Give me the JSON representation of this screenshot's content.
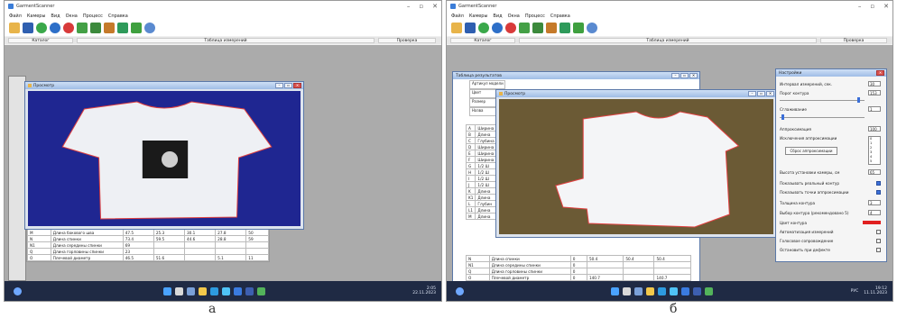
{
  "panel_a": {
    "app_title": "GarmentScanner",
    "menu": [
      "Файл",
      "Камеры",
      "Вид",
      "Окна",
      "Процесс",
      "Справка"
    ],
    "tabs": [
      "Каталог",
      "Таблица измерений",
      "Проверка"
    ],
    "preview_title": "Просмотр",
    "table_rows": [
      {
        "code": "M",
        "name": "Длина бокового шва",
        "v1": "47.5",
        "v2": "25.3",
        "v3": "30.1",
        "v4": "27.8",
        "v5": "50"
      },
      {
        "code": "N",
        "name": "Длина спинки",
        "v1": "73.4",
        "v2": "59.5",
        "v3": "44.6",
        "v4": "28.8",
        "v5": "59"
      },
      {
        "code": "N1",
        "name": "Длина середины спинки",
        "v1": "69",
        "v2": "",
        "v3": "",
        "v4": "",
        "v5": ""
      },
      {
        "code": "Q",
        "name": "Длина горловины спинки",
        "v1": "23",
        "v2": "",
        "v3": "",
        "v4": "",
        "v5": ""
      },
      {
        "code": "O",
        "name": "Плечевой диаметр",
        "v1": "46.5",
        "v2": "51.6",
        "v3": "",
        "v4": "5.1",
        "v5": "11"
      }
    ],
    "tray_time": "2:05",
    "tray_date": "22.11.2023",
    "caption": "а"
  },
  "panel_b": {
    "app_title": "GarmentScanner",
    "menu": [
      "Файл",
      "Камеры",
      "Вид",
      "Окна",
      "Процесс",
      "Справка"
    ],
    "tabs": [
      "Каталог",
      "Таблица измерений",
      "Проверка"
    ],
    "results_title": "Таблица результатов",
    "preview_title": "Просмотр",
    "header_rows": [
      "Артикул модели",
      "Цвет",
      "Размер",
      "Назва"
    ],
    "left_codes": [
      "A",
      "B",
      "C",
      "D",
      "E",
      "F",
      "G",
      "H",
      "I",
      "J",
      "K",
      "K1",
      "L",
      "L1",
      "M"
    ],
    "left_names": [
      "Ширина",
      "Длина",
      "Глубина",
      "Ширина",
      "Ширина",
      "Ширина",
      "1/2 Ш",
      "1/2 Ш",
      "1/2 Ш",
      "1/2 Ш",
      "Длина",
      "Длина",
      "Глубин",
      "Длина",
      "Длина"
    ],
    "bottom_rows": [
      {
        "code": "N",
        "name": "Длина спинки",
        "v1": "0",
        "v2": "50.4",
        "v3": "50.4",
        "v4": "50.4"
      },
      {
        "code": "N1",
        "name": "Длина середины спинки",
        "v1": "0",
        "v2": "",
        "v3": "",
        "v4": ""
      },
      {
        "code": "Q",
        "name": "Длина горловины спинки",
        "v1": "0",
        "v2": "",
        "v3": "",
        "v4": ""
      },
      {
        "code": "O",
        "name": "Плечевой диаметр",
        "v1": "0",
        "v2": "140.7",
        "v3": "",
        "v4": "140.7"
      }
    ],
    "settings": {
      "title": "Настройки",
      "interval_label": "Интервал измерений, сек.",
      "interval_value": "30",
      "threshold_label": "Порог контура",
      "threshold_value": "153",
      "smoothing_label": "Сглаживание",
      "smoothing_value": "1",
      "approx_label": "Аппроксимация",
      "approx_value": "100",
      "approx_exclusions_label": "Исключения аппроксимации",
      "approx_list": [
        "0",
        "1",
        "2",
        "3",
        "4",
        "5"
      ],
      "reset_approx_label": "Сброс аппроксимации",
      "camera_height_label": "Высота установки камеры, см",
      "camera_height_value": "65",
      "show_real_contour": "Показывать реальный контур",
      "show_approx_points": "Показывать точки аппроксимации",
      "contour_thickness_label": "Толщина контура",
      "contour_thickness_value": "3",
      "contour_choice_label": "Выбор контура (рекомендовано 5)",
      "contour_choice_value": "4",
      "contour_color_label": "Цвет контура",
      "contour_color": "#e02020",
      "auto_measure": "Автоматизация измерений",
      "voice": "Голосовое сопровождение",
      "stop_on_defect": "Остановить при дефекте"
    },
    "tray_text": "РУС",
    "tray_time": "19:12",
    "tray_date": "11.11.2023",
    "caption": "б"
  }
}
